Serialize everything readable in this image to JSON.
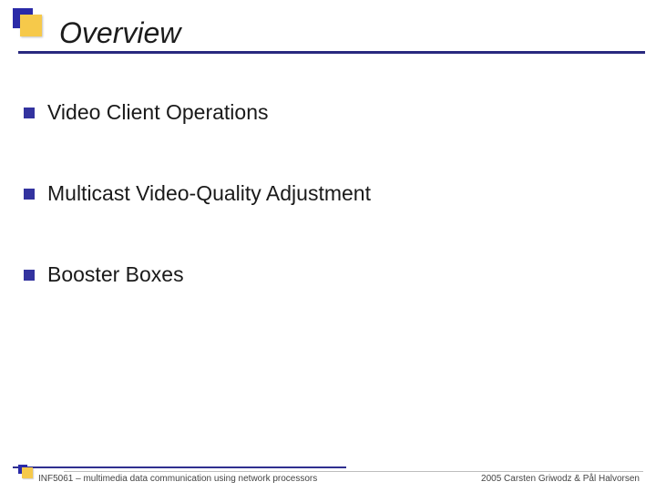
{
  "title": "Overview",
  "bullets": [
    "Video Client Operations",
    "Multicast Video-Quality Adjustment",
    "Booster Boxes"
  ],
  "footer": {
    "left": "INF5061 – multimedia data communication using network processors",
    "right": "2005 Carsten Griwodz & Pål Halvorsen"
  },
  "colors": {
    "accent_blue": "#2a2aa8",
    "accent_yellow": "#f6c94a",
    "rule": "#29297f"
  }
}
